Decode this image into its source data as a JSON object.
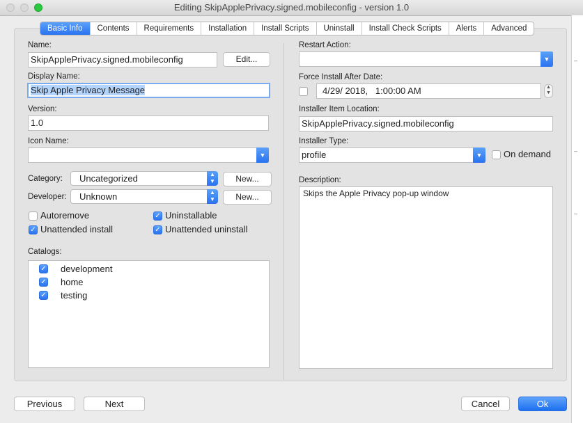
{
  "window": {
    "title": "Editing SkipApplePrivacy.signed.mobileconfig - version 1.0"
  },
  "tabs": [
    "Basic Info",
    "Contents",
    "Requirements",
    "Installation",
    "Install Scripts",
    "Uninstall",
    "Install Check Scripts",
    "Alerts",
    "Advanced"
  ],
  "left": {
    "name_label": "Name:",
    "name_value": "SkipApplePrivacy.signed.mobileconfig",
    "edit_button": "Edit...",
    "display_name_label": "Display Name:",
    "display_name_value": "Skip Apple Privacy Message",
    "version_label": "Version:",
    "version_value": "1.0",
    "icon_name_label": "Icon Name:",
    "icon_name_value": "",
    "category_label": "Category:",
    "category_value": "Uncategorized",
    "category_new": "New...",
    "developer_label": "Developer:",
    "developer_value": "Unknown",
    "developer_new": "New...",
    "checks": {
      "autoremove": "Autoremove",
      "uninstallable": "Uninstallable",
      "unattended_install": "Unattended install",
      "unattended_uninstall": "Unattended uninstall"
    },
    "catalogs_label": "Catalogs:",
    "catalogs": [
      "development",
      "home",
      "testing"
    ]
  },
  "right": {
    "restart_label": "Restart Action:",
    "restart_value": "",
    "force_label": "Force Install After Date:",
    "force_date": "4/29/ 2018,",
    "force_time": "1:00:00 AM",
    "location_label": "Installer Item Location:",
    "location_value": "SkipApplePrivacy.signed.mobileconfig",
    "type_label": "Installer Type:",
    "type_value": "profile",
    "on_demand_label": "On demand",
    "description_label": "Description:",
    "description_value": "Skips the Apple Privacy pop-up window"
  },
  "footer": {
    "previous": "Previous",
    "next": "Next",
    "cancel": "Cancel",
    "ok": "Ok"
  },
  "colors": {
    "accent": "#2a73ef",
    "selection": "#b3d4fd"
  }
}
